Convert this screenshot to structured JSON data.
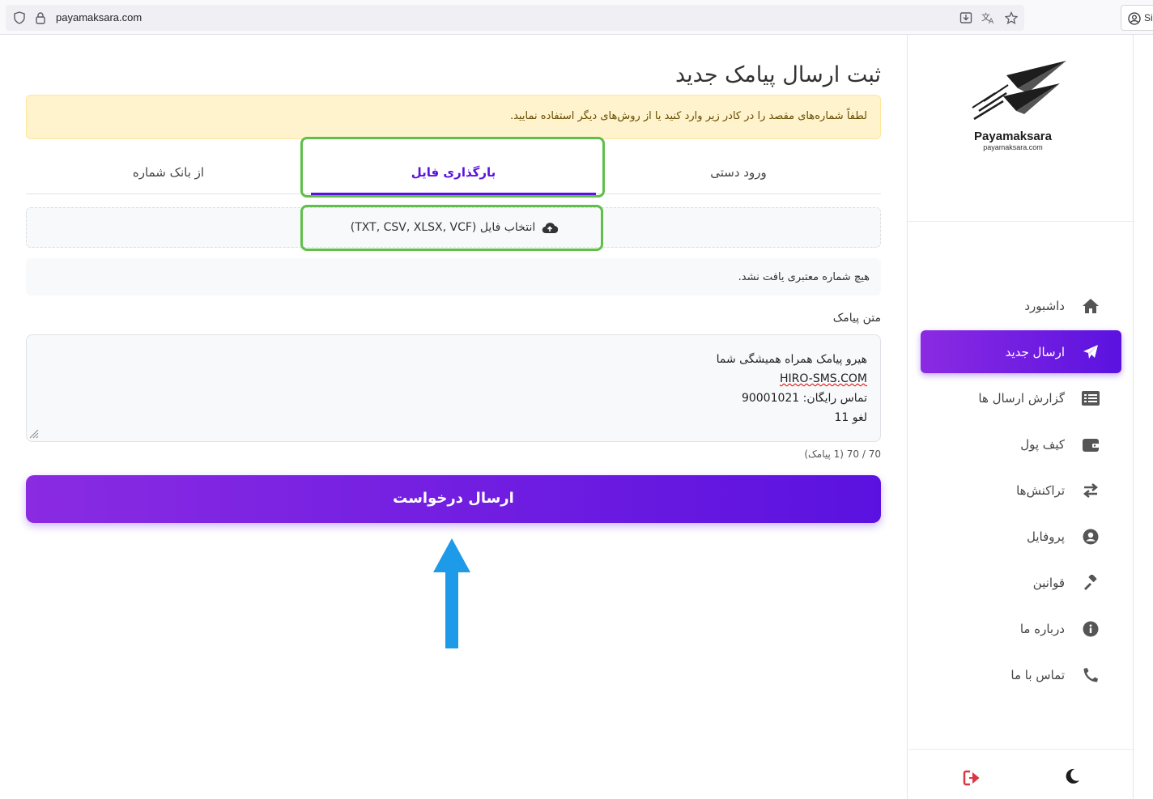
{
  "browser": {
    "url": "payamaksara.com",
    "right_chip": "Si"
  },
  "sidebar": {
    "logo_name": "Payamaksara",
    "logo_sub": "payamaksara.com",
    "items": [
      {
        "label": "داشبورد",
        "icon": "home-icon"
      },
      {
        "label": "ارسال جدید",
        "icon": "paper-plane-icon",
        "active": true
      },
      {
        "label": "گزارش ارسال ها",
        "icon": "list-icon"
      },
      {
        "label": "کیف پول",
        "icon": "wallet-icon"
      },
      {
        "label": "تراکنش‌ها",
        "icon": "exchange-icon"
      },
      {
        "label": "پروفایل",
        "icon": "user-circle-icon"
      },
      {
        "label": "قوانین",
        "icon": "gavel-icon"
      },
      {
        "label": "درباره ما",
        "icon": "info-icon"
      },
      {
        "label": "تماس با ما",
        "icon": "phone-icon"
      }
    ]
  },
  "main": {
    "title": "ثبت ارسال پیامک جدید",
    "alert": "لطفاً شماره‌های مقصد را در کادر زیر وارد کنید یا از روش‌های دیگر استفاده نمایید.",
    "tabs": [
      "ورود دستی",
      "بارگذاری فایل",
      "از بانک شماره"
    ],
    "dropzone_label": "انتخاب فایل (TXT, CSV, XLSX, VCF)",
    "info": "هیچ شماره معتبری یافت نشد.",
    "message_label": "متن پیامک",
    "message_lines": [
      "هیرو پیامک همراه همیشگی شما",
      "HIRO-SMS.COM",
      "تماس رایگان: 90001021",
      "لغو 11"
    ],
    "counter": "70 / 70 (1 پیامک)",
    "submit_label": "ارسال درخواست"
  },
  "colors": {
    "accent": "#5b12e0",
    "accent_light": "#8a2be2",
    "highlight": "#5fbf4a",
    "annotation_arrow": "#1e9be8"
  }
}
